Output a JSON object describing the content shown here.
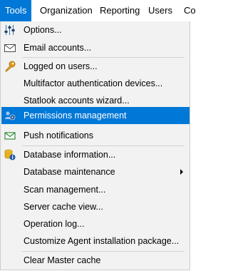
{
  "menubar": {
    "items": [
      "Tools",
      "Organization",
      "Reporting",
      "Users",
      "Co"
    ]
  },
  "menu": {
    "items": [
      {
        "label": "Options...",
        "icon": "sliders-icon"
      },
      {
        "label": "Email accounts...",
        "icon": "envelope-icon"
      },
      {
        "label": "Logged on users...",
        "icon": "key-icon"
      },
      {
        "label": "Multifactor authentication devices..."
      },
      {
        "label": "Statlook accounts wizard..."
      },
      {
        "label": "Permissions management",
        "icon": "users-gear-icon"
      },
      {
        "label": "Push notifications",
        "icon": "push-envelope-icon"
      },
      {
        "label": "Database information...",
        "icon": "database-info-icon"
      },
      {
        "label": "Database maintenance",
        "submenu": true
      },
      {
        "label": "Scan management..."
      },
      {
        "label": "Server cache view..."
      },
      {
        "label": "Operation log..."
      },
      {
        "label": "Customize Agent installation package..."
      },
      {
        "label": "Clear Master cache"
      }
    ]
  },
  "colors": {
    "accent": "#0078d7",
    "menu_bg": "#f2f2f2",
    "separator": "#d2d2d2"
  }
}
